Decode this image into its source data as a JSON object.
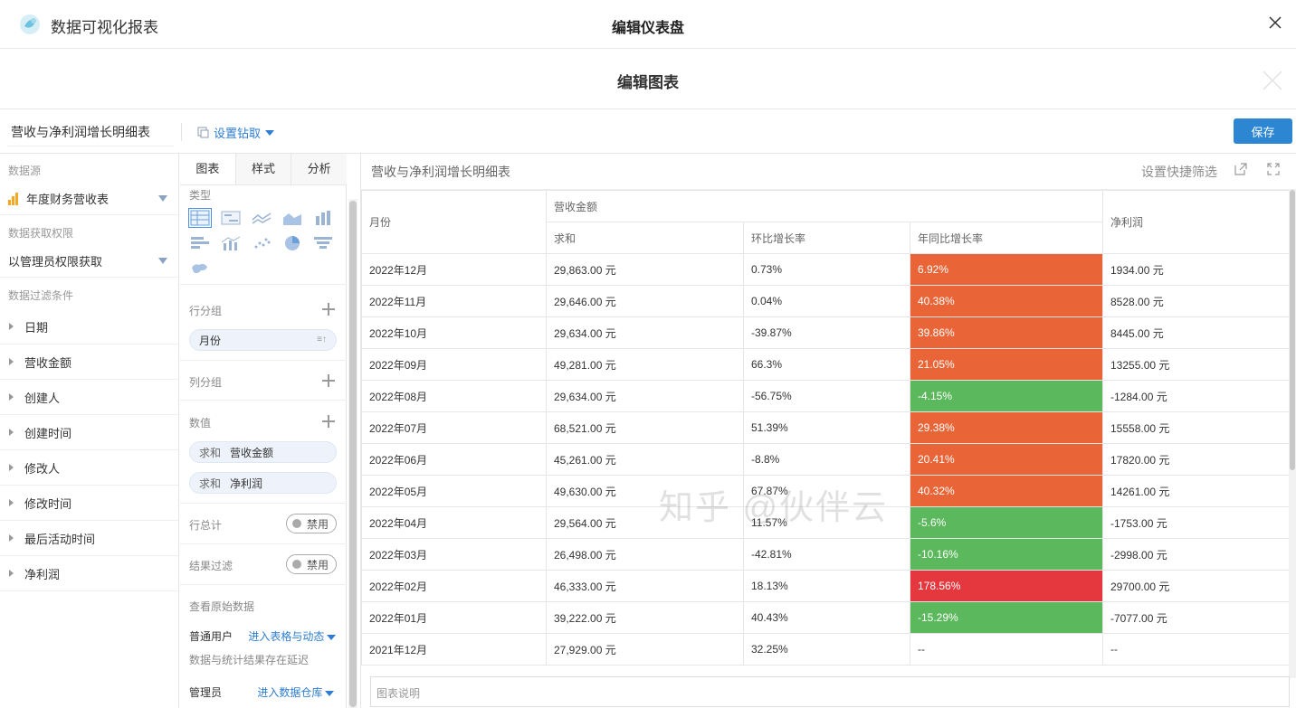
{
  "app": {
    "name": "数据可视化报表",
    "dashboard_title": "编辑仪表盘"
  },
  "editor": {
    "title": "编辑图表"
  },
  "toolbar": {
    "chart_name": "营收与净利润增长明细表",
    "drill_label": "设置钻取",
    "save_label": "保存"
  },
  "left": {
    "datasource_label": "数据源",
    "datasource_value": "年度财务营收表",
    "permission_label": "数据获取权限",
    "permission_value": "以管理员权限获取",
    "filter_label": "数据过滤条件",
    "filters": [
      "日期",
      "营收金额",
      "创建人",
      "创建时间",
      "修改人",
      "修改时间",
      "最后活动时间",
      "净利润"
    ]
  },
  "middle": {
    "tabs": [
      "图表",
      "样式",
      "分析"
    ],
    "type_label": "类型",
    "chart_types": [
      "table-icon",
      "kpi-card-icon",
      "line-chart-icon",
      "area-chart-icon",
      "bar-chart-icon",
      "horizontal-bar-icon",
      "combo-chart-icon",
      "scatter-icon",
      "pie-chart-icon",
      "funnel-icon",
      "map-icon"
    ],
    "row_group_label": "行分组",
    "row_group_field": "月份",
    "col_group_label": "列分组",
    "values_label": "数值",
    "value_fields": [
      {
        "agg": "求和",
        "name": "营收金额"
      },
      {
        "agg": "求和",
        "name": "净利润"
      }
    ],
    "row_total_label": "行总计",
    "row_total_toggle": "禁用",
    "result_filter_label": "结果过滤",
    "result_filter_toggle": "禁用",
    "raw_data_label": "查看原始数据",
    "normal_user_label": "普通用户",
    "normal_user_link": "进入表格与动态",
    "delay_note": "数据与统计结果存在延迟",
    "admin_label": "管理员",
    "admin_link": "进入数据仓库"
  },
  "chart": {
    "title": "营收与净利润增长明细表",
    "quick_filter": "设置快捷筛选",
    "caption_placeholder": "图表说明",
    "colors": {
      "high": "#e96436",
      "low": "#5cb85c",
      "peak": "#e5383e"
    }
  },
  "chart_data": {
    "type": "table",
    "headers": {
      "month": "月份",
      "revenue_group": "营收金额",
      "sum": "求和",
      "mom": "环比增长率",
      "yoy": "年同比增长率",
      "profit": "净利润"
    },
    "rows": [
      {
        "month": "2022年12月",
        "sum": "29,863.00 元",
        "mom": "0.73%",
        "yoy": "6.92%",
        "yoy_level": "high",
        "profit": "1934.00 元"
      },
      {
        "month": "2022年11月",
        "sum": "29,646.00 元",
        "mom": "0.04%",
        "yoy": "40.38%",
        "yoy_level": "high",
        "profit": "8528.00 元"
      },
      {
        "month": "2022年10月",
        "sum": "29,634.00 元",
        "mom": "-39.87%",
        "yoy": "39.86%",
        "yoy_level": "high",
        "profit": "8445.00 元"
      },
      {
        "month": "2022年09月",
        "sum": "49,281.00 元",
        "mom": "66.3%",
        "yoy": "21.05%",
        "yoy_level": "high",
        "profit": "13255.00 元"
      },
      {
        "month": "2022年08月",
        "sum": "29,634.00 元",
        "mom": "-56.75%",
        "yoy": "-4.15%",
        "yoy_level": "low",
        "profit": "-1284.00 元"
      },
      {
        "month": "2022年07月",
        "sum": "68,521.00 元",
        "mom": "51.39%",
        "yoy": "29.38%",
        "yoy_level": "high",
        "profit": "15558.00 元"
      },
      {
        "month": "2022年06月",
        "sum": "45,261.00 元",
        "mom": "-8.8%",
        "yoy": "20.41%",
        "yoy_level": "high",
        "profit": "17820.00 元"
      },
      {
        "month": "2022年05月",
        "sum": "49,630.00 元",
        "mom": "67.87%",
        "yoy": "40.32%",
        "yoy_level": "high",
        "profit": "14261.00 元"
      },
      {
        "month": "2022年04月",
        "sum": "29,564.00 元",
        "mom": "11.57%",
        "yoy": "-5.6%",
        "yoy_level": "low",
        "profit": "-1753.00 元"
      },
      {
        "month": "2022年03月",
        "sum": "26,498.00 元",
        "mom": "-42.81%",
        "yoy": "-10.16%",
        "yoy_level": "low",
        "profit": "-2998.00 元"
      },
      {
        "month": "2022年02月",
        "sum": "46,333.00 元",
        "mom": "18.13%",
        "yoy": "178.56%",
        "yoy_level": "peak",
        "profit": "29700.00 元"
      },
      {
        "month": "2022年01月",
        "sum": "39,222.00 元",
        "mom": "40.43%",
        "yoy": "-15.29%",
        "yoy_level": "low",
        "profit": "-7077.00 元"
      },
      {
        "month": "2021年12月",
        "sum": "27,929.00 元",
        "mom": "32.25%",
        "yoy": "--",
        "yoy_level": "none",
        "profit": "--"
      }
    ]
  },
  "watermark": "知乎 @伙伴云"
}
